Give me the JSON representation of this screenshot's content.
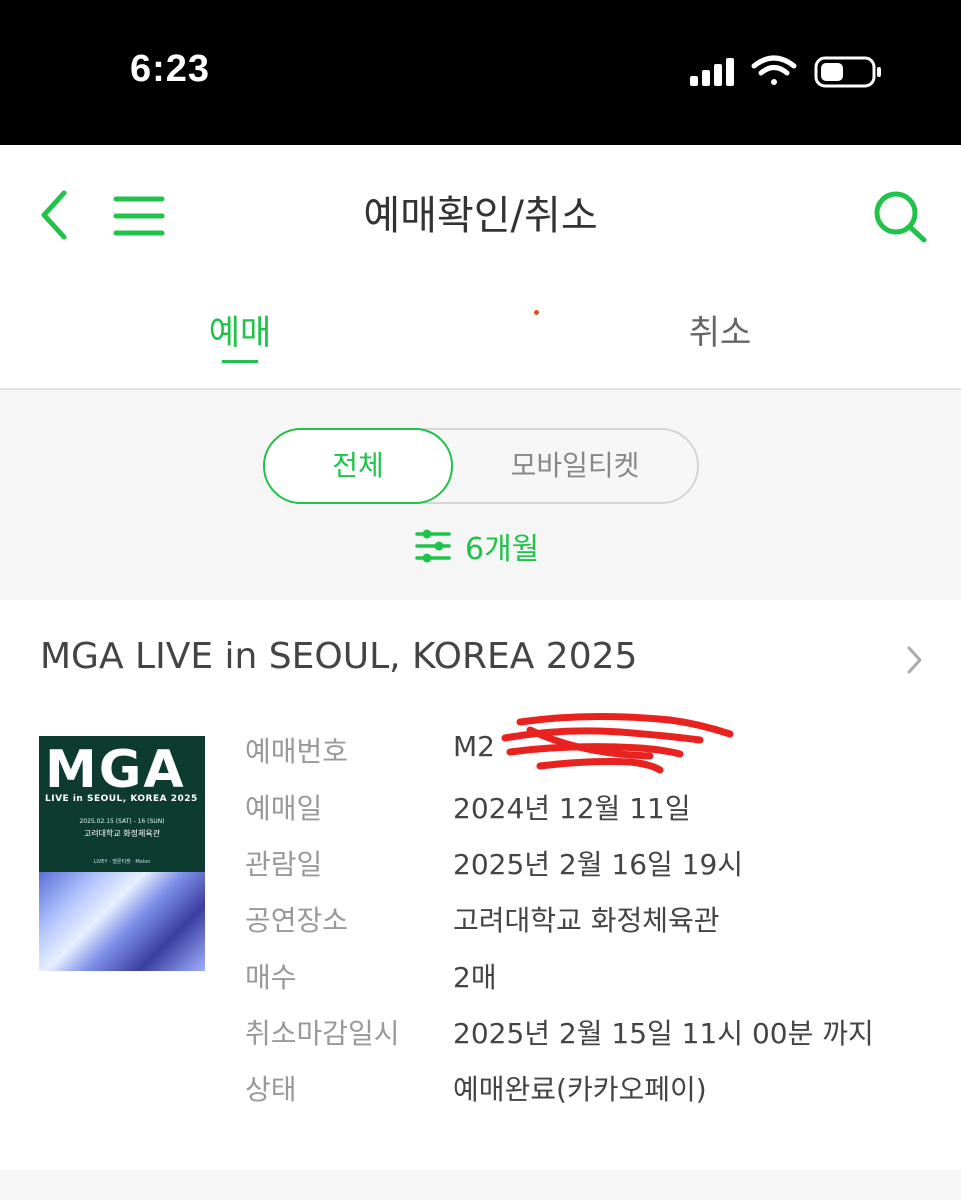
{
  "status_bar": {
    "time": "6:23"
  },
  "header": {
    "title": "예매확인/취소"
  },
  "tabs": {
    "reserve": "예매",
    "cancel": "취소"
  },
  "filter": {
    "all": "전체",
    "mobile_ticket": "모바일티켓",
    "period": "6개월"
  },
  "booking": {
    "title": "MGA LIVE in SEOUL, KOREA 2025",
    "poster": {
      "logo": "MGA",
      "subtitle": "LIVE in SEOUL, KOREA 2025",
      "date": "2025.02.15 (SAT) - 16 (SUN)",
      "venue": "고려대학교 화정체육관",
      "sponsors": "LIVEY · 멜론티켓 · Melon"
    },
    "rows": [
      {
        "label": "예매번호",
        "value": "M2"
      },
      {
        "label": "예매일",
        "value": "2024년 12월 11일"
      },
      {
        "label": "관람일",
        "value": "2025년 2월 16일 19시"
      },
      {
        "label": "공연장소",
        "value": "고려대학교 화정체육관"
      },
      {
        "label": "매수",
        "value": "2매"
      },
      {
        "label": "취소마감일시",
        "value": "2025년 2월 15일 11시 00분 까지"
      },
      {
        "label": "상태",
        "value": "예매완료(카카오페이)"
      }
    ]
  },
  "colors": {
    "accent": "#1fc34a",
    "status_bar": "#000000",
    "filter_bg": "#f6f6f6"
  }
}
